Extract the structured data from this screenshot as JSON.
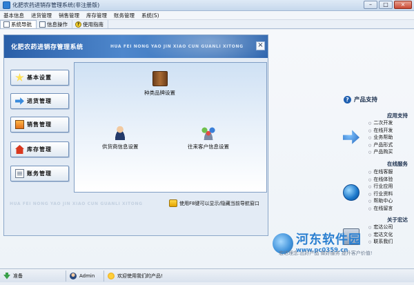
{
  "window": {
    "title": "化肥农药进销存管理系统(非注册版)",
    "buttons": {
      "minimize": "–",
      "maximize": "□",
      "close": "×"
    }
  },
  "menubar": {
    "items": [
      "基本信息",
      "进货管理",
      "销售管理",
      "库存管理",
      "账务管理",
      "系统(S)"
    ]
  },
  "tabs": [
    {
      "label": "系统导航",
      "icon": "nav-icon",
      "active": true
    },
    {
      "label": "信息操作",
      "icon": "info-icon",
      "active": false
    },
    {
      "label": "使用指南",
      "icon": "help-icon",
      "active": false
    }
  ],
  "nav_panel": {
    "title": "化肥农药进销存管理系统",
    "subtitle": "HUA FEI NONG YAO JIN XIAO CUN GUANLI XITONG",
    "close_label": "×",
    "side_buttons": [
      {
        "label": "基本设置",
        "icon": "star-icon"
      },
      {
        "label": "进货管理",
        "icon": "arrow-icon"
      },
      {
        "label": "销售管理",
        "icon": "monitor-icon"
      },
      {
        "label": "库存管理",
        "icon": "house-icon"
      },
      {
        "label": "账务管理",
        "icon": "document-icon"
      }
    ],
    "features": [
      {
        "label": "种类品牌设置",
        "icon": "book-icon"
      },
      {
        "label": "供货商信息设置",
        "icon": "person-icon"
      },
      {
        "label": "往来客户信息设置",
        "icon": "people-icon"
      }
    ],
    "footer_text": "HUA FEI NONG YAO JIN XIAO CUN GUANLI XITONG",
    "hint": "使用F8键可以显示/隐藏当前导航窗口"
  },
  "support": {
    "title": "产品支持",
    "sections": [
      {
        "title": "应用支持",
        "icon": "arrow-support-icon",
        "items": [
          "二次开发",
          "在线开发",
          "业务帮助",
          "产品形式",
          "产品购买"
        ]
      },
      {
        "title": "在线服务",
        "icon": "globe-icon",
        "items": [
          "在线客服",
          "在线体验",
          "行业应用",
          "行业资料",
          "帮助中心",
          "在线留言"
        ]
      },
      {
        "title": "关于宏达",
        "icon": "computer-icon",
        "items": [
          "宏达公司",
          "宏达文化",
          "联系我们"
        ]
      }
    ],
    "promo": "宏达理念:出好产品 做好服务 提升客户价值!"
  },
  "watermark": {
    "name": "河东软件园",
    "url": "www.pc0359.cn"
  },
  "statusbar": {
    "ready": "准备",
    "user": "Admin",
    "welcome": "欢迎使用我们的产品!"
  }
}
